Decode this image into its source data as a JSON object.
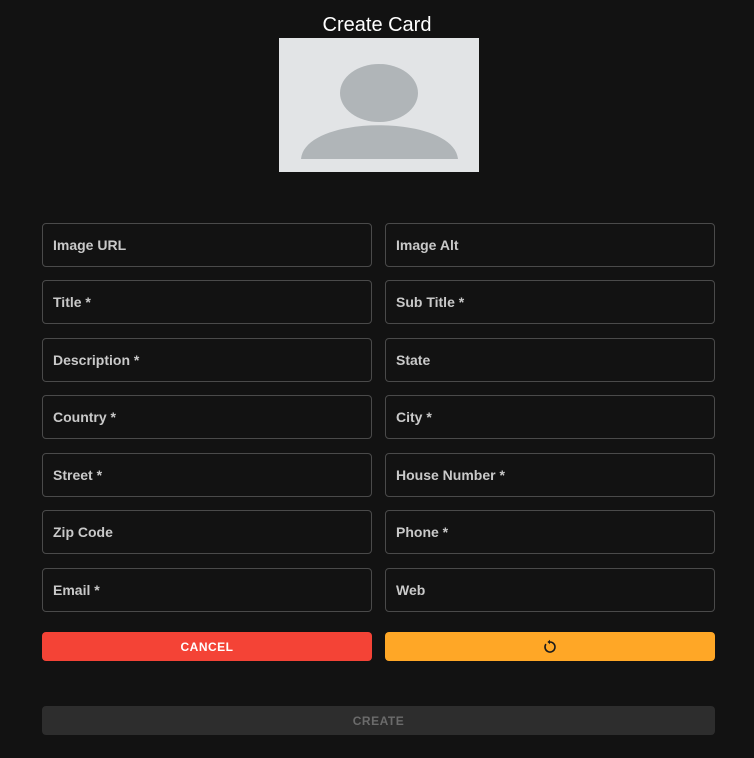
{
  "page": {
    "title": "Create Card"
  },
  "avatar": {
    "icon": "person-placeholder-icon",
    "bg_color": "#e2e4e6",
    "fg_color": "#b0b5b8"
  },
  "form": {
    "fields": [
      {
        "name": "image-url-field",
        "placeholder": "Image URL",
        "value": ""
      },
      {
        "name": "image-alt-field",
        "placeholder": "Image Alt",
        "value": ""
      },
      {
        "name": "title-field",
        "placeholder": "Title *",
        "value": ""
      },
      {
        "name": "sub-title-field",
        "placeholder": "Sub Title *",
        "value": ""
      },
      {
        "name": "description-field",
        "placeholder": "Description *",
        "value": ""
      },
      {
        "name": "state-field",
        "placeholder": "State",
        "value": ""
      },
      {
        "name": "country-field",
        "placeholder": "Country *",
        "value": ""
      },
      {
        "name": "city-field",
        "placeholder": "City *",
        "value": ""
      },
      {
        "name": "street-field",
        "placeholder": "Street *",
        "value": ""
      },
      {
        "name": "house-number-field",
        "placeholder": "House Number *",
        "value": ""
      },
      {
        "name": "zip-code-field",
        "placeholder": "Zip Code",
        "value": ""
      },
      {
        "name": "phone-field",
        "placeholder": "Phone *",
        "value": ""
      },
      {
        "name": "email-field",
        "placeholder": "Email *",
        "value": ""
      },
      {
        "name": "web-field",
        "placeholder": "Web",
        "value": ""
      }
    ]
  },
  "actions": {
    "cancel_label": "CANCEL",
    "reset_icon": "refresh-icon",
    "create_label": "CREATE",
    "create_disabled": true
  },
  "colors": {
    "background": "#121212",
    "cancel": "#f44336",
    "reset": "#ffa726",
    "create_disabled": "#2d2d2d",
    "field_border": "#4a4a4a"
  }
}
